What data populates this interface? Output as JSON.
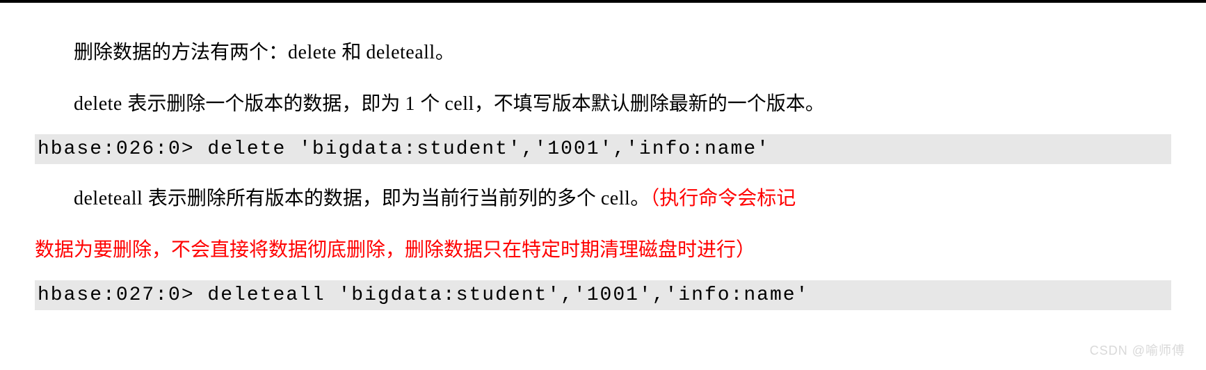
{
  "intro_a": "删除数据的方法有两个：",
  "intro_b_latin": "delete ",
  "intro_c": "和 ",
  "intro_d_latin": "deleteall",
  "intro_e": "。",
  "p2": {
    "a_latin": "delete ",
    "b": "表示删除一个版本的数据，即为 ",
    "c_latin": "1 ",
    "d": "个 ",
    "e_latin": "cell",
    "f": "，不填写版本默认删除最新的一个版本。"
  },
  "code1": "hbase:026:0> delete 'bigdata:student','1001','info:name'",
  "p3": {
    "a_latin": "deleteall ",
    "b": "表示删除所有版本的数据，即为当前行当前列的多个 ",
    "c_latin": "cell",
    "d": "。",
    "red1": "（执行命令会标记",
    "red2": "数据为要删除，不会直接将数据彻底删除，删除数据只在特定时期清理磁盘时进行）"
  },
  "code2": "hbase:027:0> deleteall 'bigdata:student','1001','info:name'",
  "watermark": "CSDN @喻师傅"
}
